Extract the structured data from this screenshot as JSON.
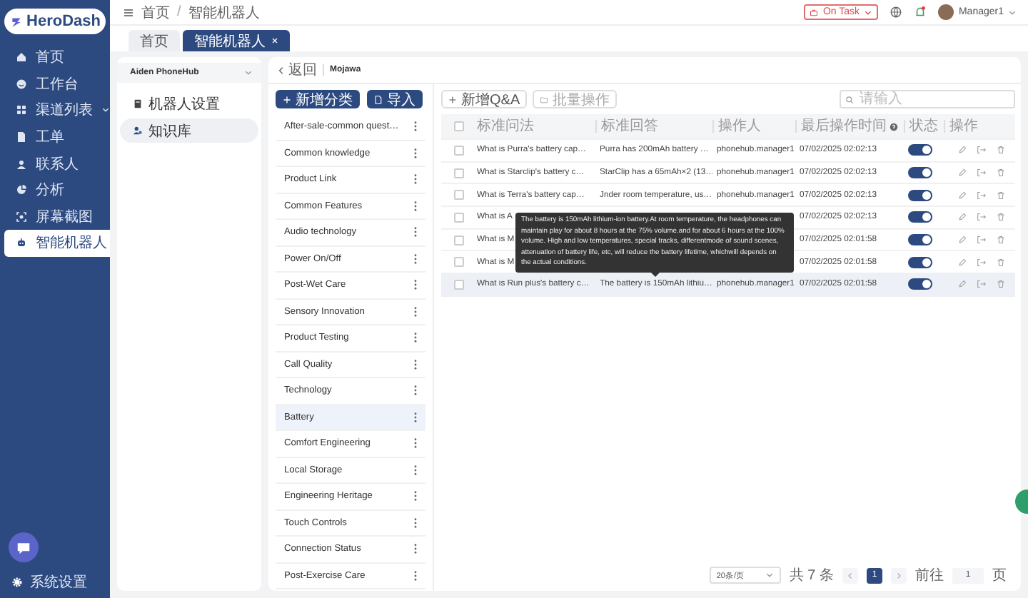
{
  "sidebar": {
    "logo": "HeroDash",
    "items": [
      {
        "label": "首页",
        "selected": false,
        "expandable": false
      },
      {
        "label": "工作台",
        "selected": false,
        "expandable": false
      },
      {
        "label": "渠道列表",
        "selected": false,
        "expandable": true
      },
      {
        "label": "工单",
        "selected": false,
        "expandable": false
      },
      {
        "label": "联系人",
        "selected": false,
        "expandable": false
      },
      {
        "label": "分析",
        "selected": false,
        "expandable": false
      },
      {
        "label": "屏幕截图",
        "selected": false,
        "expandable": false
      },
      {
        "label": "智能机器人",
        "selected": true,
        "expandable": false
      }
    ],
    "settings": "系统设置"
  },
  "header": {
    "breadcrumb": [
      "首页",
      "智能机器人"
    ],
    "breadcrumb_separator": "/",
    "status": "On Task",
    "user": "Manager1"
  },
  "tabs": [
    {
      "label": "首页",
      "selected": false,
      "closable": false
    },
    {
      "label": "智能机器人",
      "selected": true,
      "closable": true
    }
  ],
  "bot_panel": {
    "bot_select": "Aiden PhoneHub",
    "items": [
      {
        "label": "机器人设置",
        "selected": false
      },
      {
        "label": "知识库",
        "selected": true
      }
    ]
  },
  "content": {
    "back": "返回",
    "title": "Mojawa",
    "category_buttons": [
      "新增分类",
      "导入"
    ],
    "categories": [
      {
        "label": "After-sale-common quest…",
        "selected": false
      },
      {
        "label": "Common knowledge",
        "selected": false
      },
      {
        "label": "Product Link",
        "selected": false
      },
      {
        "label": "Common Features",
        "selected": false
      },
      {
        "label": "Audio technology",
        "selected": false
      },
      {
        "label": "Power On/Off",
        "selected": false
      },
      {
        "label": "Post-Wet Care",
        "selected": false
      },
      {
        "label": "Sensory Innovation",
        "selected": false
      },
      {
        "label": "Product Testing",
        "selected": false
      },
      {
        "label": "Call Quality",
        "selected": false
      },
      {
        "label": "Technology",
        "selected": false
      },
      {
        "label": "Battery",
        "selected": true
      },
      {
        "label": "Comfort Engineering",
        "selected": false
      },
      {
        "label": "Local Storage",
        "selected": false
      },
      {
        "label": "Engineering Heritage",
        "selected": false
      },
      {
        "label": "Touch Controls",
        "selected": false
      },
      {
        "label": "Connection Status",
        "selected": false
      },
      {
        "label": "Post-Exercise Care",
        "selected": false
      }
    ],
    "toolbar": {
      "add": "新增Q&A",
      "batch": "批量操作",
      "batch_disabled": true,
      "search_placeholder": "请输入"
    },
    "table": {
      "select_all_checked": false,
      "columns": [
        "标准问法",
        "标准回答",
        "操作人",
        "最后操作时间",
        "状态",
        "操作"
      ],
      "rows": [
        {
          "question": "What is Purra's battery cap…",
          "answer": "Purra has 200mAh battery …",
          "operator": "phonehub.manager1",
          "time": "07/02/2025 02:02:13",
          "checked": false,
          "on": true,
          "hovered": false
        },
        {
          "question": "What is Starclip's battery c…",
          "answer": "StarClip has a 65mAh×2 (13…",
          "operator": "phonehub.manager1",
          "time": "07/02/2025 02:02:13",
          "checked": false,
          "on": true,
          "hovered": false
        },
        {
          "question": "What is Terra's battery cap…",
          "answer": "Jnder room temperature, us…",
          "operator": "phonehub.manager1",
          "time": "07/02/2025 02:02:13",
          "checked": false,
          "on": true,
          "hovered": false
        },
        {
          "question": "What is A",
          "time": "07/02/2025 02:02:13",
          "checked": false,
          "on": true,
          "hovered": false
        },
        {
          "question": "What is M",
          "time": "07/02/2025 02:01:58",
          "checked": false,
          "on": true,
          "hovered": false
        },
        {
          "question": "What is M",
          "time": "07/02/2025 02:01:58",
          "checked": false,
          "on": true,
          "hovered": false
        },
        {
          "question": "What is Run plus's battery c…",
          "answer": "The battery is 150mAh lithiu…",
          "operator": "phonehub.manager1",
          "time": "07/02/2025 02:01:58",
          "checked": false,
          "on": true,
          "hovered": true
        }
      ]
    },
    "tooltip": "The battery is 150mAh lithium-ion battery.At room temperature, the headphones can maintain play for about 8 hours at the 75% volume.and for about 6 hours at the 100% volume. High and low temperatures, special tracks, differentmode of sound scenes, attenuation of battery life, etc, will reduce the battery lifetime, whichwill depends on the actual conditions.",
    "pagination": {
      "page_size": "20条/页",
      "total": "共 7 条",
      "pages": [
        {
          "label": "1",
          "selected": true
        }
      ],
      "goto_label": "前往",
      "goto_value": "1",
      "page_suffix": "页"
    }
  }
}
